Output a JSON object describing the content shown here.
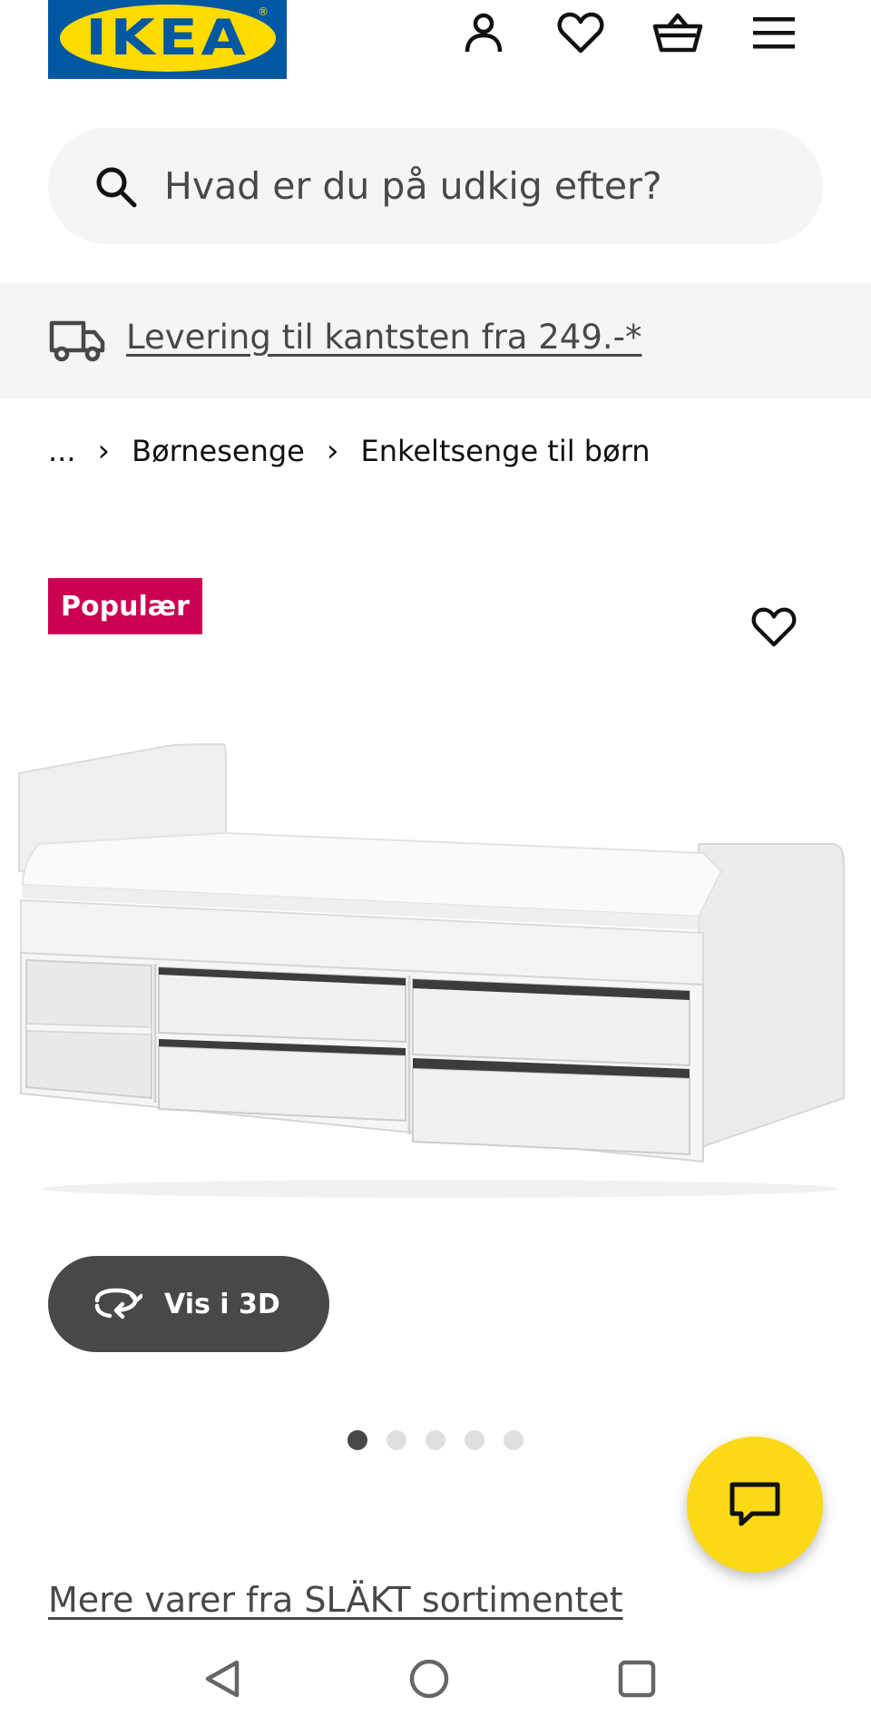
{
  "header": {
    "logo_text": "IKEA",
    "logo_registered": "®",
    "icons": [
      "person-icon",
      "heart-icon",
      "basket-icon",
      "hamburger-menu-icon"
    ]
  },
  "search": {
    "placeholder": "Hvad er du på udkig efter?",
    "value": ""
  },
  "delivery": {
    "link_text": "Levering til kantsten fra 249.-*",
    "icon": "truck-icon"
  },
  "breadcrumb": {
    "items": [
      "...",
      "Børnesenge",
      "Enkeltsenge til børn"
    ],
    "separator": "›"
  },
  "product": {
    "badge": "Populær",
    "badge_color": "#cc0050",
    "favorite_icon": "heart-icon",
    "image": "white-single-bed-with-drawers-and-shelves",
    "view_3d_label": "Vis i 3D",
    "view_3d_icon": "rotate-arrows-icon",
    "carousel": {
      "count": 5,
      "active": 1
    }
  },
  "chat": {
    "icon": "chat-bubble-icon",
    "color": "#fbd914"
  },
  "range_link": "Mere varer fra SLÄKT sortimentet",
  "system_nav": [
    "back-icon",
    "home-icon",
    "recents-icon"
  ],
  "colors": {
    "ikea_blue": "#0058a3",
    "ikea_yellow": "#ffdb00",
    "dark_gray": "#484848",
    "light_gray": "#f5f5f5"
  }
}
